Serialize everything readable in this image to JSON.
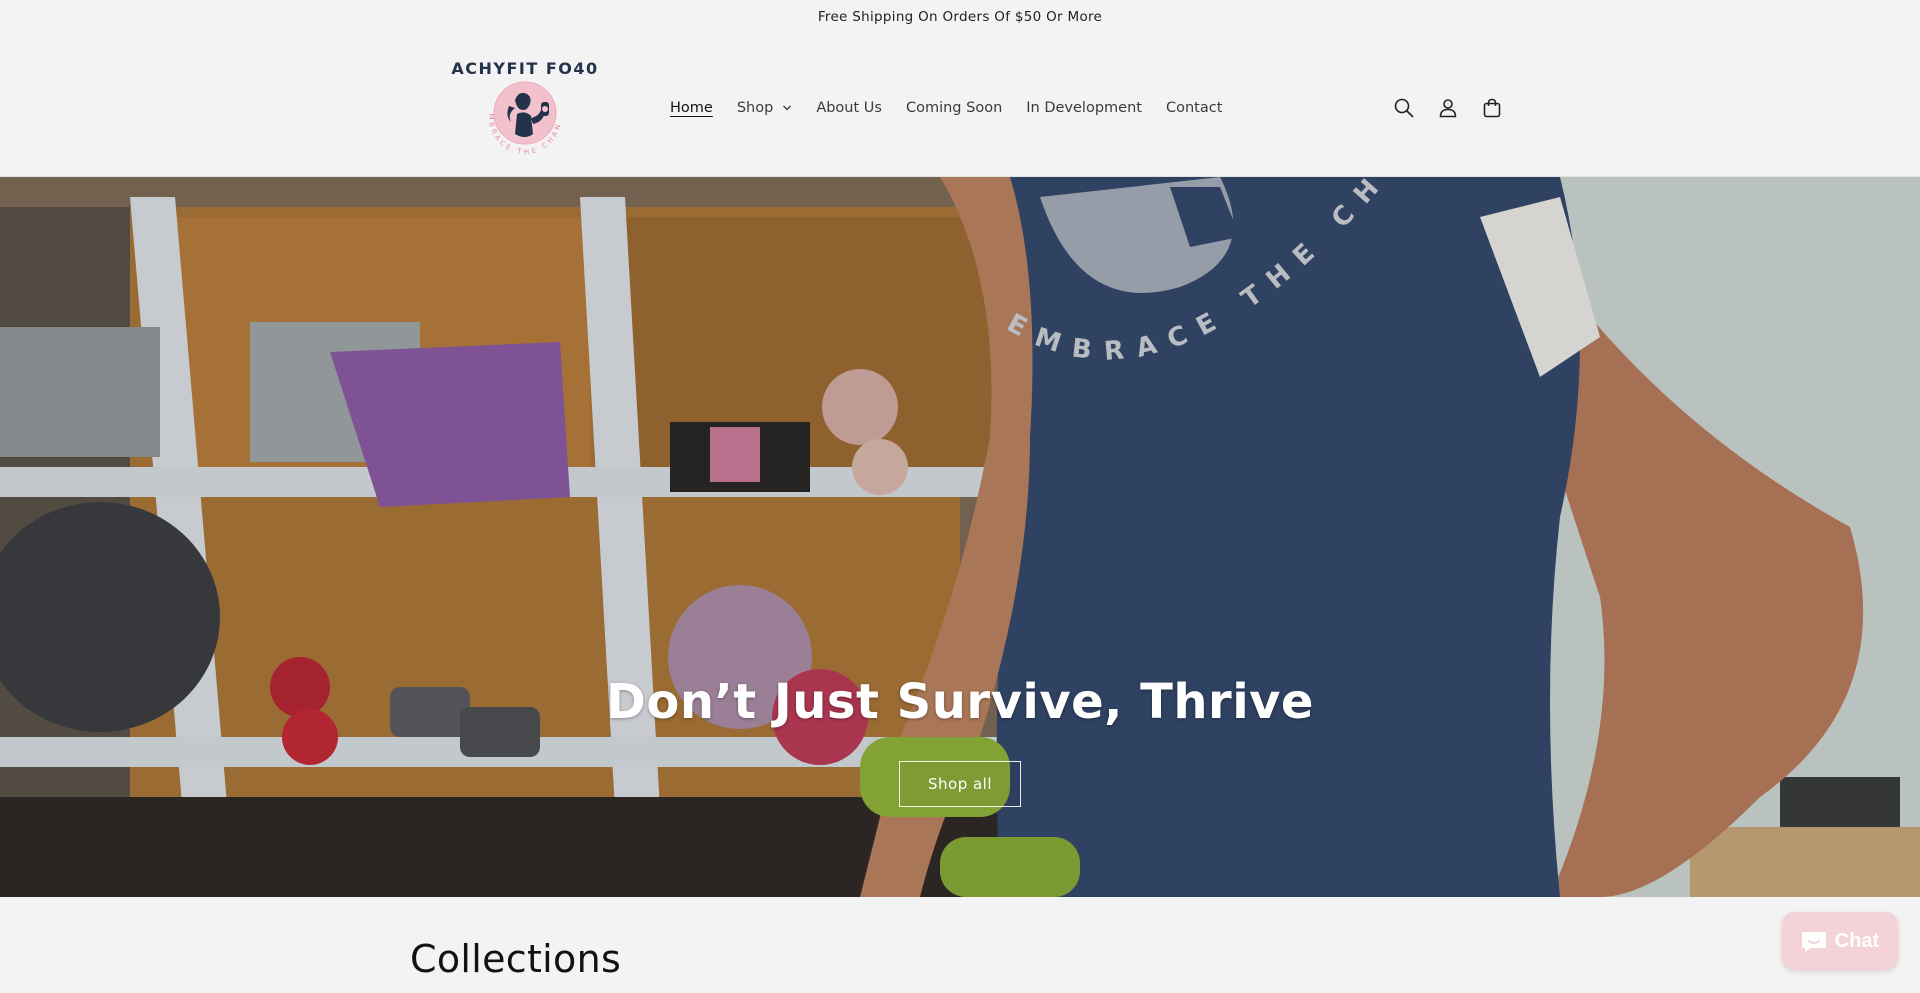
{
  "announcement": {
    "text": "Free Shipping On Orders Of $50 Or More"
  },
  "header": {
    "logo": {
      "brand": "ACHYFIT FO40",
      "tagline": "EMBRACE THE CHANGE"
    },
    "nav": [
      {
        "label": "Home",
        "active": true
      },
      {
        "label": "Shop",
        "has_dropdown": true
      },
      {
        "label": "About Us"
      },
      {
        "label": "Coming Soon"
      },
      {
        "label": "In Development"
      },
      {
        "label": "Contact"
      }
    ],
    "icons": [
      "search-icon",
      "account-icon",
      "cart-icon"
    ]
  },
  "hero": {
    "heading": "Don’t Just Survive, Thrive",
    "button_label": "Shop all",
    "shirt_print": "EMBRACE THE CHANGE"
  },
  "collections": {
    "heading": "Collections"
  },
  "chat_widget": {
    "label": "Chat",
    "color": "#f3d3d8"
  },
  "colors": {
    "background": "#f3f3f3",
    "text": "#121212",
    "logo_navy": "#24324a",
    "logo_pink": "#f2b8c6"
  }
}
